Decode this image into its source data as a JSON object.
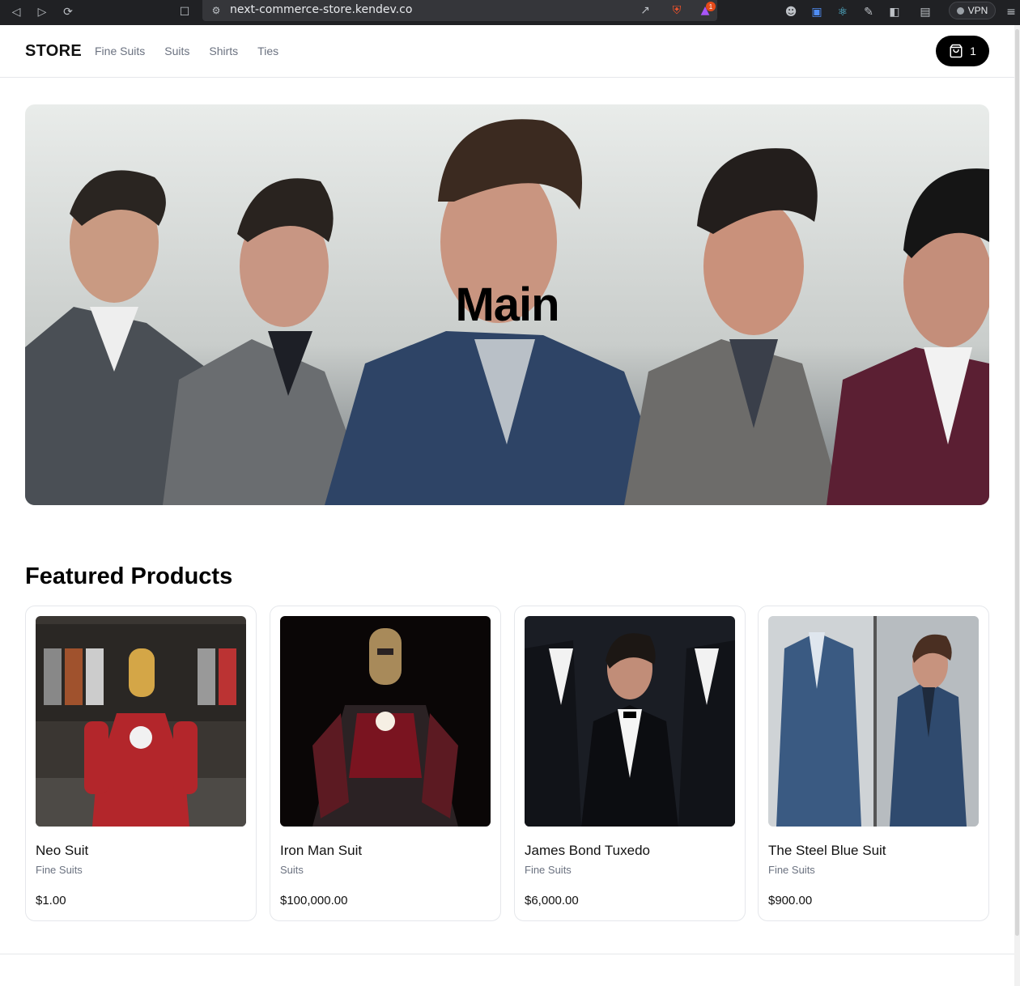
{
  "browser": {
    "url": "next-commerce-store.kendev.co",
    "vpn_label": "VPN",
    "notification_count": "1"
  },
  "header": {
    "brand": "STORE",
    "nav": [
      "Fine Suits",
      "Suits",
      "Shirts",
      "Ties"
    ],
    "cart_count": "1"
  },
  "hero": {
    "title": "Main"
  },
  "featured": {
    "title": "Featured Products",
    "products": [
      {
        "name": "Neo Suit",
        "category": "Fine Suits",
        "price": "$1.00"
      },
      {
        "name": "Iron Man Suit",
        "category": "Suits",
        "price": "$100,000.00"
      },
      {
        "name": "James Bond Tuxedo",
        "category": "Fine Suits",
        "price": "$6,000.00"
      },
      {
        "name": "The Steel Blue Suit",
        "category": "Fine Suits",
        "price": "$900.00"
      }
    ]
  },
  "colors": {
    "primary": "#000000",
    "muted": "#6b7280",
    "border": "#e5e7eb",
    "chrome": "#202124"
  }
}
